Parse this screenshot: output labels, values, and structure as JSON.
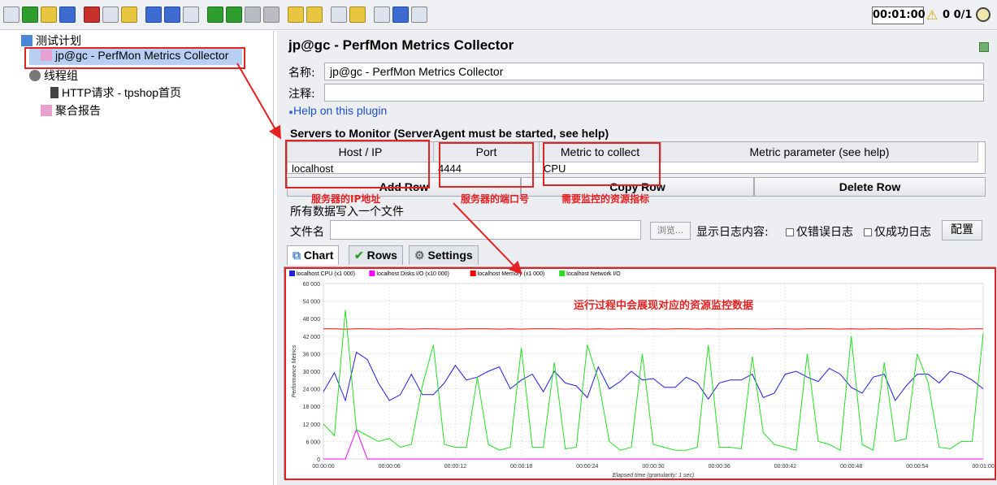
{
  "toolbar": {
    "icons": [
      "new-icon",
      "templates-icon",
      "open-icon",
      "save-icon",
      "cut-icon",
      "copy-icon",
      "paste-icon",
      "expand-icon",
      "collapse-icon",
      "toggle-icon",
      "start-icon",
      "start-no-pause-icon",
      "stop-icon",
      "shutdown-icon",
      "clear-icon",
      "clear-all-icon",
      "search-icon",
      "reset-search-icon",
      "function-helper-icon",
      "help-icon",
      "remote-icon"
    ],
    "timer": "00:01:00",
    "warning_count": "0 0/1"
  },
  "tree": {
    "items": [
      {
        "label": "测试计划",
        "icon": "test-plan-icon"
      },
      {
        "label": "jp@gc - PerfMon Metrics Collector",
        "icon": "perfmon-icon"
      },
      {
        "label": "线程组",
        "icon": "thread-group-icon"
      },
      {
        "label": "HTTP请求 - tpshop首页",
        "icon": "http-sampler-icon"
      },
      {
        "label": "聚合报告",
        "icon": "aggregate-report-icon"
      }
    ]
  },
  "panel": {
    "title": "jp@gc - PerfMon Metrics Collector",
    "name_label": "名称:",
    "name_value": "jp@gc - PerfMon Metrics Collector",
    "comment_label": "注释:",
    "comment_value": "",
    "help_link": "Help on this plugin",
    "servers_title": "Servers to Monitor (ServerAgent must be started, see help)",
    "columns": [
      "Host / IP",
      "Port",
      "Metric to collect",
      "Metric parameter (see help)"
    ],
    "row": {
      "host": "localhost",
      "port": "4444",
      "metric": "CPU",
      "param": ""
    },
    "buttons": {
      "add": "Add Row",
      "copy": "Copy Row",
      "delete": "Delete Row"
    },
    "annotations": {
      "host": "服务器的IP地址",
      "port": "服务器的端口号",
      "metric": "需要监控的资源指标",
      "chart": "运行过程中会展现对应的资源监控数据"
    },
    "file_section_title": "所有数据写入一个文件",
    "file_label": "文件名",
    "file_value": "",
    "browse_label": "浏览...",
    "log_label": "显示日志内容:",
    "errors_only_label": "仅错误日志",
    "success_only_label": "仅成功日志",
    "config_label": "配置",
    "tabs": [
      "Chart",
      "Rows",
      "Settings"
    ]
  },
  "chart_data": {
    "type": "line",
    "xlabel": "Elapsed time (granularity: 1 sec)",
    "ylabel": "Performance Metrics",
    "ylim": [
      0,
      60000
    ],
    "yticks": [
      "0",
      "6 000",
      "12 000",
      "18 000",
      "24 000",
      "30 000",
      "36 000",
      "42 000",
      "48 000",
      "54 000",
      "60 000"
    ],
    "xticks": [
      "00:00:00",
      "00:00:06",
      "00:00:12",
      "00:00:18",
      "00:00:24",
      "00:00:30",
      "00:00:36",
      "00:00:42",
      "00:00:48",
      "00:00:54",
      "00:01:00"
    ],
    "x_seconds": [
      0,
      1,
      2,
      3,
      4,
      5,
      6,
      7,
      8,
      9,
      10,
      11,
      12,
      13,
      14,
      15,
      16,
      17,
      18,
      19,
      20,
      21,
      22,
      23,
      24,
      25,
      26,
      27,
      28,
      29,
      30,
      31,
      32,
      33,
      34,
      35,
      36,
      37,
      38,
      39,
      40,
      41,
      42,
      43,
      44,
      45,
      46,
      47,
      48,
      49,
      50,
      51,
      52,
      53,
      54,
      55,
      56,
      57,
      58,
      59,
      60
    ],
    "series": [
      {
        "name": "localhost CPU (x1 000)",
        "color": "#1f1fe0",
        "values": [
          23000,
          29500,
          20000,
          36500,
          34000,
          26000,
          20000,
          22000,
          29000,
          22000,
          22000,
          26000,
          32000,
          27000,
          28000,
          30000,
          31500,
          24000,
          27000,
          29000,
          23000,
          30000,
          26000,
          25000,
          21000,
          31500,
          24000,
          26500,
          30000,
          27000,
          27500,
          24500,
          24500,
          28000,
          26000,
          20500,
          26000,
          27000,
          27000,
          29000,
          21000,
          22500,
          29000,
          30000,
          28000,
          26500,
          31000,
          29000,
          24500,
          22500,
          28000,
          29000,
          20000,
          25000,
          29000,
          29000,
          26000,
          30000,
          29000,
          27000,
          24000
        ]
      },
      {
        "name": "localhost Disks I/O (x10 000)",
        "color": "#ff00ff",
        "values": [
          0,
          0,
          0,
          10000,
          0,
          0,
          0,
          0,
          0,
          0,
          0,
          0,
          0,
          0,
          0,
          0,
          0,
          0,
          0,
          0,
          0,
          0,
          0,
          0,
          0,
          0,
          0,
          0,
          0,
          0,
          0,
          0,
          0,
          0,
          0,
          0,
          0,
          0,
          0,
          0,
          0,
          0,
          0,
          0,
          0,
          0,
          0,
          0,
          0,
          0,
          0,
          0,
          0,
          0,
          0,
          0,
          0,
          0,
          0,
          0,
          0
        ]
      },
      {
        "name": "localhost Memory (x1 000)",
        "color": "#ff0000",
        "values": [
          44500,
          44500,
          44400,
          44500,
          44500,
          44400,
          44400,
          44500,
          44400,
          44500,
          44500,
          44400,
          44400,
          44500,
          44500,
          44500,
          44400,
          44500,
          44400,
          44500,
          44500,
          44500,
          44400,
          44500,
          44400,
          44500,
          44400,
          44500,
          44500,
          44400,
          44500,
          44400,
          44500,
          44500,
          44400,
          44500,
          44400,
          44500,
          44500,
          44500,
          44400,
          44500,
          44500,
          44400,
          44500,
          44500,
          44500,
          44400,
          44500,
          44400,
          44500,
          44500,
          44400,
          44500,
          44500,
          44500,
          44400,
          44500,
          44400,
          44500,
          44500
        ]
      },
      {
        "name": "localhost Network I/O",
        "color": "#22e022",
        "values": [
          12000,
          8000,
          51000,
          10000,
          8000,
          6000,
          7000,
          4000,
          5000,
          25000,
          39000,
          5000,
          4000,
          4000,
          28000,
          5000,
          3000,
          4000,
          38000,
          4000,
          4000,
          33000,
          3500,
          4000,
          39000,
          27000,
          6000,
          3000,
          4000,
          36000,
          5000,
          4000,
          3000,
          3000,
          4000,
          39000,
          4000,
          4000,
          3500,
          35000,
          9000,
          5000,
          4000,
          3000,
          36000,
          6000,
          5000,
          3000,
          42000,
          5000,
          3000,
          33000,
          6000,
          7000,
          36000,
          26000,
          4000,
          3500,
          6000,
          6000,
          43000
        ]
      }
    ]
  }
}
